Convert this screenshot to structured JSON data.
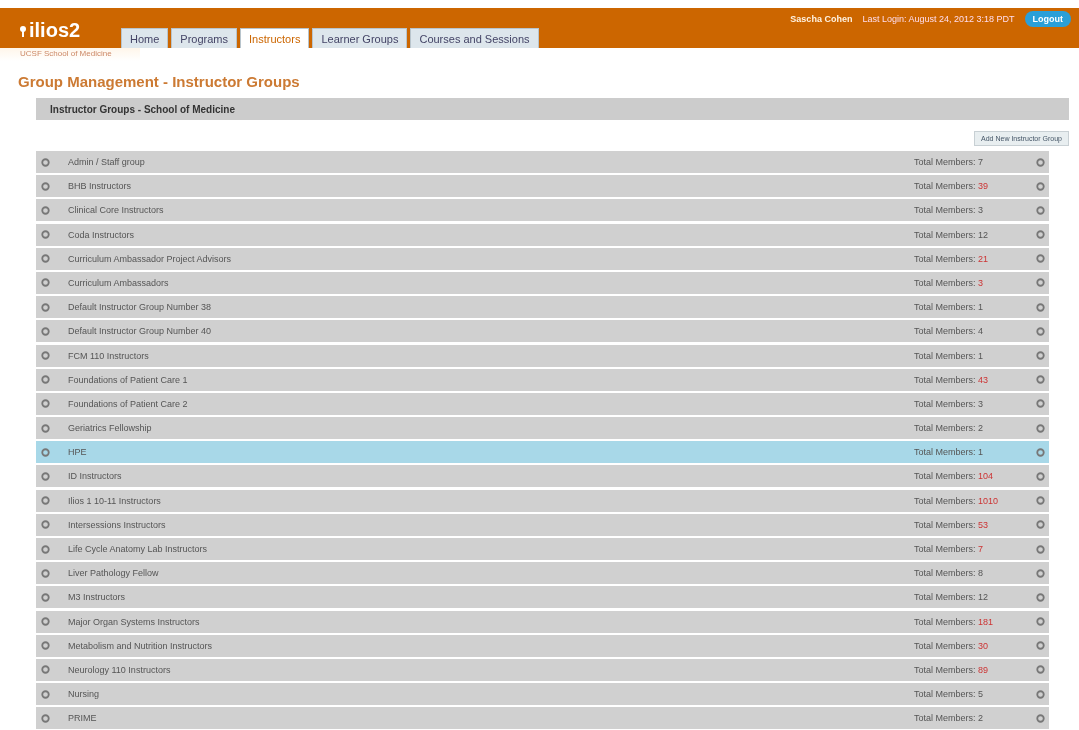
{
  "header": {
    "logo": "ilios2",
    "school": "UCSF School of Medicine",
    "user": "Sascha Cohen",
    "last_login": "Last Login: August 24, 2012 3:18 PDT",
    "logout": "Logout",
    "tabs": [
      {
        "label": "Home",
        "selected": false
      },
      {
        "label": "Programs",
        "selected": false
      },
      {
        "label": "Instructors",
        "selected": true
      },
      {
        "label": "Learner Groups",
        "selected": false
      },
      {
        "label": "Courses and Sessions",
        "selected": false
      }
    ]
  },
  "page_title": "Group Management - Instructor Groups",
  "section_title": "Instructor Groups - School of Medicine",
  "add_button": "Add New Instructor Group",
  "groups": [
    {
      "name": "Admin / Staff group",
      "members_label": "Total Members:",
      "count": "7",
      "count_flagged": false,
      "selected": false
    },
    {
      "name": "BHB Instructors",
      "members_label": "Total Members:",
      "count": "39",
      "count_flagged": true,
      "selected": false
    },
    {
      "name": "Clinical Core Instructors",
      "members_label": "Total Members:",
      "count": "3",
      "count_flagged": false,
      "selected": false
    },
    {
      "name": "Coda Instructors",
      "members_label": "Total Members:",
      "count": "12",
      "count_flagged": false,
      "selected": false
    },
    {
      "name": "Curriculum Ambassador Project Advisors",
      "members_label": "Total Members:",
      "count": "21",
      "count_flagged": true,
      "selected": false
    },
    {
      "name": "Curriculum Ambassadors",
      "members_label": "Total Members:",
      "count": "3",
      "count_flagged": true,
      "selected": false
    },
    {
      "name": "Default Instructor Group Number 38",
      "members_label": "Total Members:",
      "count": "1",
      "count_flagged": false,
      "selected": false
    },
    {
      "name": "Default Instructor Group Number 40",
      "members_label": "Total Members:",
      "count": "4",
      "count_flagged": false,
      "selected": false
    },
    {
      "name": "FCM 110 Instructors",
      "members_label": "Total Members:",
      "count": "1",
      "count_flagged": false,
      "selected": false
    },
    {
      "name": "Foundations of Patient Care 1",
      "members_label": "Total Members:",
      "count": "43",
      "count_flagged": true,
      "selected": false
    },
    {
      "name": "Foundations of Patient Care 2",
      "members_label": "Total Members:",
      "count": "3",
      "count_flagged": false,
      "selected": false
    },
    {
      "name": "Geriatrics Fellowship",
      "members_label": "Total Members:",
      "count": "2",
      "count_flagged": false,
      "selected": false
    },
    {
      "name": "HPE",
      "members_label": "Total Members:",
      "count": "1",
      "count_flagged": false,
      "selected": true
    },
    {
      "name": "ID Instructors",
      "members_label": "Total Members:",
      "count": "104",
      "count_flagged": true,
      "selected": false
    },
    {
      "name": "Ilios 1 10-11 Instructors",
      "members_label": "Total Members:",
      "count": "1010",
      "count_flagged": true,
      "selected": false
    },
    {
      "name": "Intersessions Instructors",
      "members_label": "Total Members:",
      "count": "53",
      "count_flagged": true,
      "selected": false
    },
    {
      "name": "Life Cycle Anatomy Lab Instructors",
      "members_label": "Total Members:",
      "count": "7",
      "count_flagged": true,
      "selected": false
    },
    {
      "name": "Liver Pathology Fellow",
      "members_label": "Total Members:",
      "count": "8",
      "count_flagged": false,
      "selected": false
    },
    {
      "name": "M3 Instructors",
      "members_label": "Total Members:",
      "count": "12",
      "count_flagged": false,
      "selected": false
    },
    {
      "name": "Major Organ Systems Instructors",
      "members_label": "Total Members:",
      "count": "181",
      "count_flagged": true,
      "selected": false
    },
    {
      "name": "Metabolism and Nutrition Instructors",
      "members_label": "Total Members:",
      "count": "30",
      "count_flagged": true,
      "selected": false
    },
    {
      "name": "Neurology 110 Instructors",
      "members_label": "Total Members:",
      "count": "89",
      "count_flagged": true,
      "selected": false
    },
    {
      "name": "Nursing",
      "members_label": "Total Members:",
      "count": "5",
      "count_flagged": false,
      "selected": false
    },
    {
      "name": "PRIME",
      "members_label": "Total Members:",
      "count": "2",
      "count_flagged": false,
      "selected": false
    }
  ]
}
